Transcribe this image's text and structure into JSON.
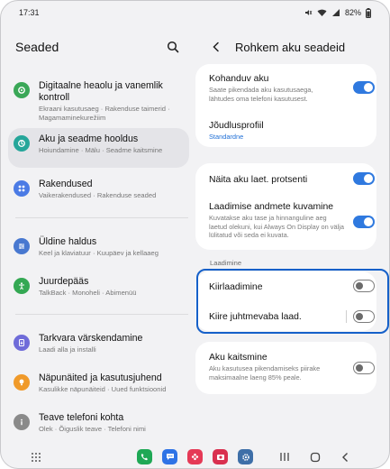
{
  "status_bar": {
    "time": "17:31",
    "battery": "82%"
  },
  "left_pane": {
    "title": "Seaded",
    "items": [
      {
        "title": "Digitaalne heaolu ja vanemlik kontroll",
        "subtitle": "Ekraani kasutusaeg ·  Rakenduse taimerid  ·  Magamaminekurežiim",
        "icon": "wellbeing-icon",
        "color": "#3aa757"
      },
      {
        "title": "Aku ja seadme hooldus",
        "subtitle": "Hoiundamine  ·  Mälu  ·  Seadme kaitsmine",
        "icon": "device-care-icon",
        "color": "#26a69a"
      },
      {
        "title": "Rakendused",
        "subtitle": "Vaikerakendused  ·  Rakenduse seaded",
        "icon": "apps-icon",
        "color": "#4b7be5"
      },
      {
        "title": "Üldine haldus",
        "subtitle": "Keel ja klaviatuur  ·  Kuupäev ja kellaaeg",
        "icon": "general-management-icon",
        "color": "#4878d0"
      },
      {
        "title": "Juurdepääs",
        "subtitle": "TalkBack  ·  Monoheli  ·  Abimenüü",
        "icon": "accessibility-icon",
        "color": "#34a853"
      },
      {
        "title": "Tarkvara värskendamine",
        "subtitle": "Laadi alla ja installi",
        "icon": "software-update-icon",
        "color": "#6f6cd9"
      },
      {
        "title": "Näpunäited ja kasutusjuhend",
        "subtitle": "Kasulikke näpunäiteid  ·  Uued funktsioonid",
        "icon": "tips-icon",
        "color": "#f09a2a"
      },
      {
        "title": "Teave telefoni kohta",
        "subtitle": "Olek  ·  Õiguslik teave  ·  Telefoni nimi",
        "icon": "about-phone-icon",
        "color": "#8a8a8a"
      }
    ]
  },
  "right_pane": {
    "title": "Rohkem aku seadeid",
    "section_label": "Laadimine",
    "rows": {
      "adaptive": {
        "title": "Kohanduv aku",
        "subtitle": "Saate pikendada aku kasutusaega, lähtudes oma telefoni kasutusest.",
        "on": true
      },
      "profile": {
        "title": "Jõudlusprofiil",
        "subtitle": "Standardne"
      },
      "percent": {
        "title": "Näita aku laet. protsenti",
        "on": true
      },
      "charging_info": {
        "title": "Laadimise andmete kuvamine",
        "subtitle": "Kuvatakse aku tase ja hinnanguline aeg laetud olekuni, kui Always On Display on välja lülitatud või seda ei kuvata.",
        "on": true
      },
      "fast": {
        "title": "Kiirlaadimine",
        "on": false
      },
      "wireless": {
        "title": "Kiire juhtmevaba laad.",
        "on": false
      },
      "protect": {
        "title": "Aku kaitsmine",
        "subtitle": "Aku kasutusea pikendamiseks piirake maksimaalne laeng 85% peale.",
        "on": false
      }
    }
  },
  "nav_bar": {
    "apps": [
      {
        "icon": "phone-app-icon",
        "color": "#1fa855"
      },
      {
        "icon": "messages-app-icon",
        "color": "#2e73e6"
      },
      {
        "icon": "flower-app-icon",
        "color": "#e53956"
      },
      {
        "icon": "camera-app-icon",
        "color": "#d9304f"
      },
      {
        "icon": "settings-app-icon",
        "color": "#3e6fa8"
      }
    ]
  }
}
